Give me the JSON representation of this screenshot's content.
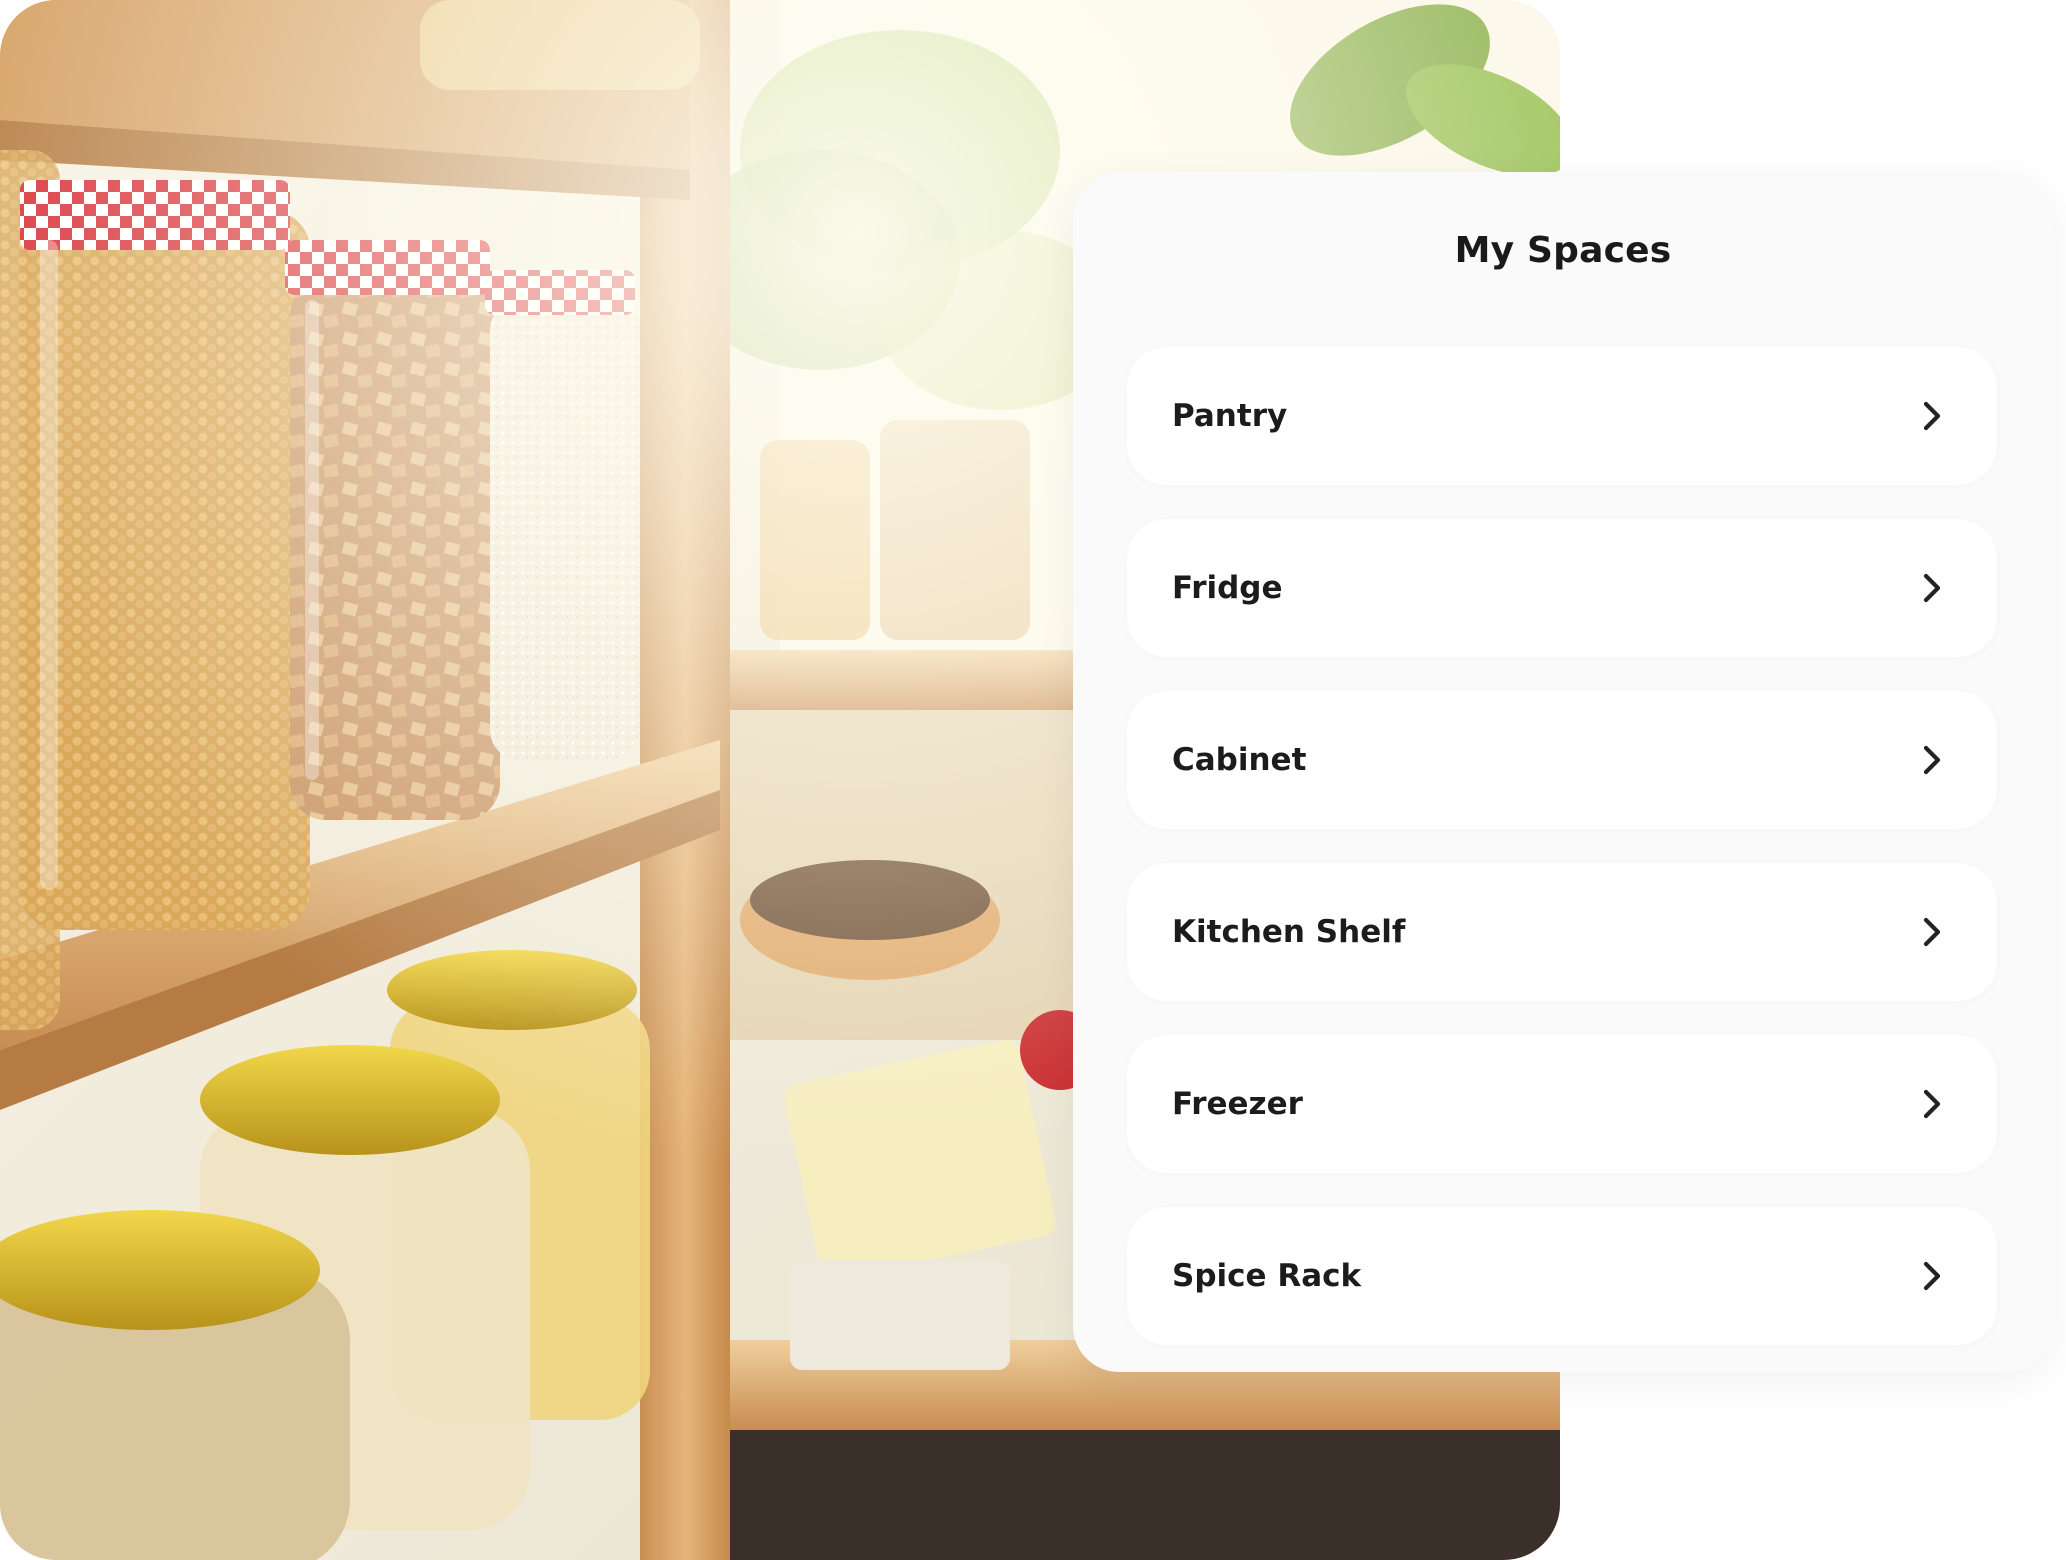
{
  "card": {
    "title": "My Spaces"
  },
  "spaces": [
    {
      "label": "Pantry",
      "icon": "chevron-right-icon"
    },
    {
      "label": "Fridge",
      "icon": "chevron-right-icon"
    },
    {
      "label": "Cabinet",
      "icon": "chevron-right-icon"
    },
    {
      "label": "Kitchen Shelf",
      "icon": "chevron-right-icon"
    },
    {
      "label": "Freezer",
      "icon": "chevron-right-icon"
    },
    {
      "label": "Spice Rack",
      "icon": "chevron-right-icon"
    }
  ],
  "colors": {
    "card_background": "#fafafa",
    "item_background": "#ffffff",
    "text": "#1c1c1c"
  }
}
